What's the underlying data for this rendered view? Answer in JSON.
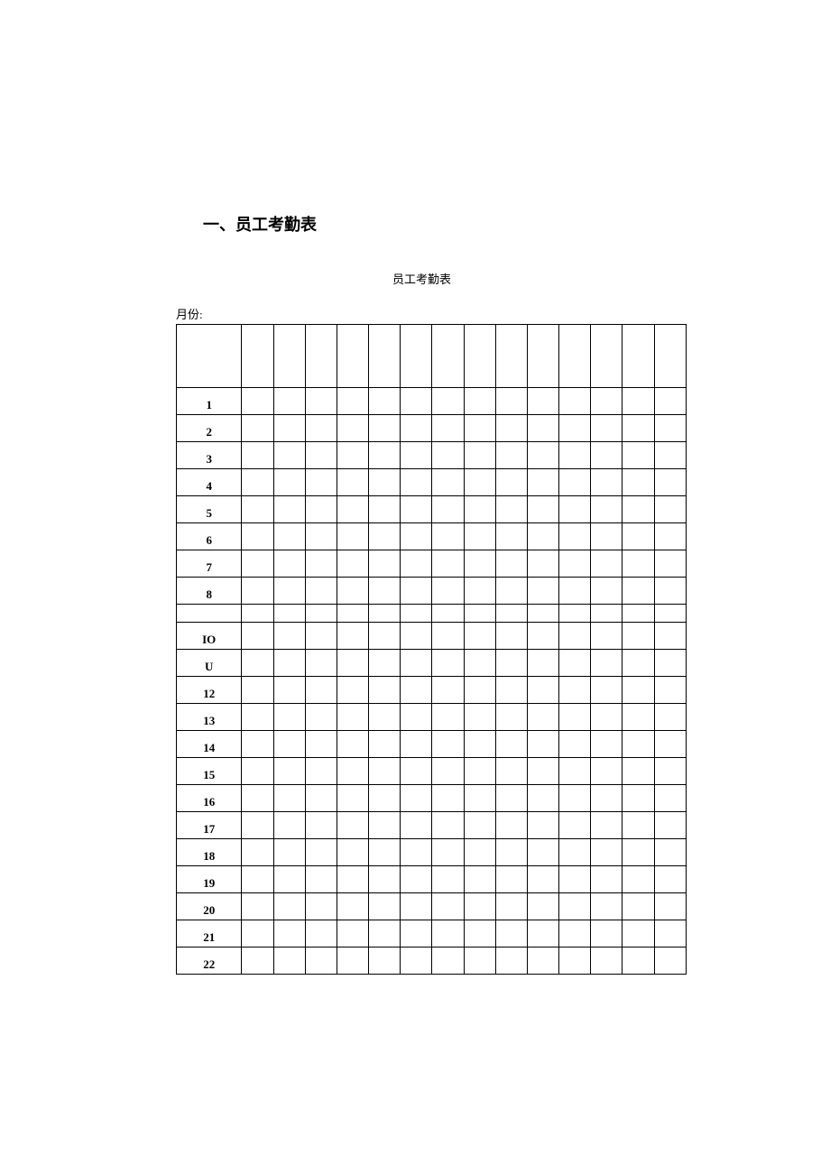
{
  "heading": "一、员工考勤表",
  "table_title": "员工考勤表",
  "month_label": "月份:",
  "rows": [
    {
      "day": ""
    },
    {
      "day": "1"
    },
    {
      "day": "2"
    },
    {
      "day": "3"
    },
    {
      "day": "4"
    },
    {
      "day": "5"
    },
    {
      "day": "6"
    },
    {
      "day": "7"
    },
    {
      "day": "8"
    },
    {
      "day": ""
    },
    {
      "day": "IO"
    },
    {
      "day": "U"
    },
    {
      "day": "12"
    },
    {
      "day": "13"
    },
    {
      "day": "14"
    },
    {
      "day": "15"
    },
    {
      "day": "16"
    },
    {
      "day": "17"
    },
    {
      "day": "18"
    },
    {
      "day": "19"
    },
    {
      "day": "20"
    },
    {
      "day": "21"
    },
    {
      "day": "22"
    }
  ]
}
